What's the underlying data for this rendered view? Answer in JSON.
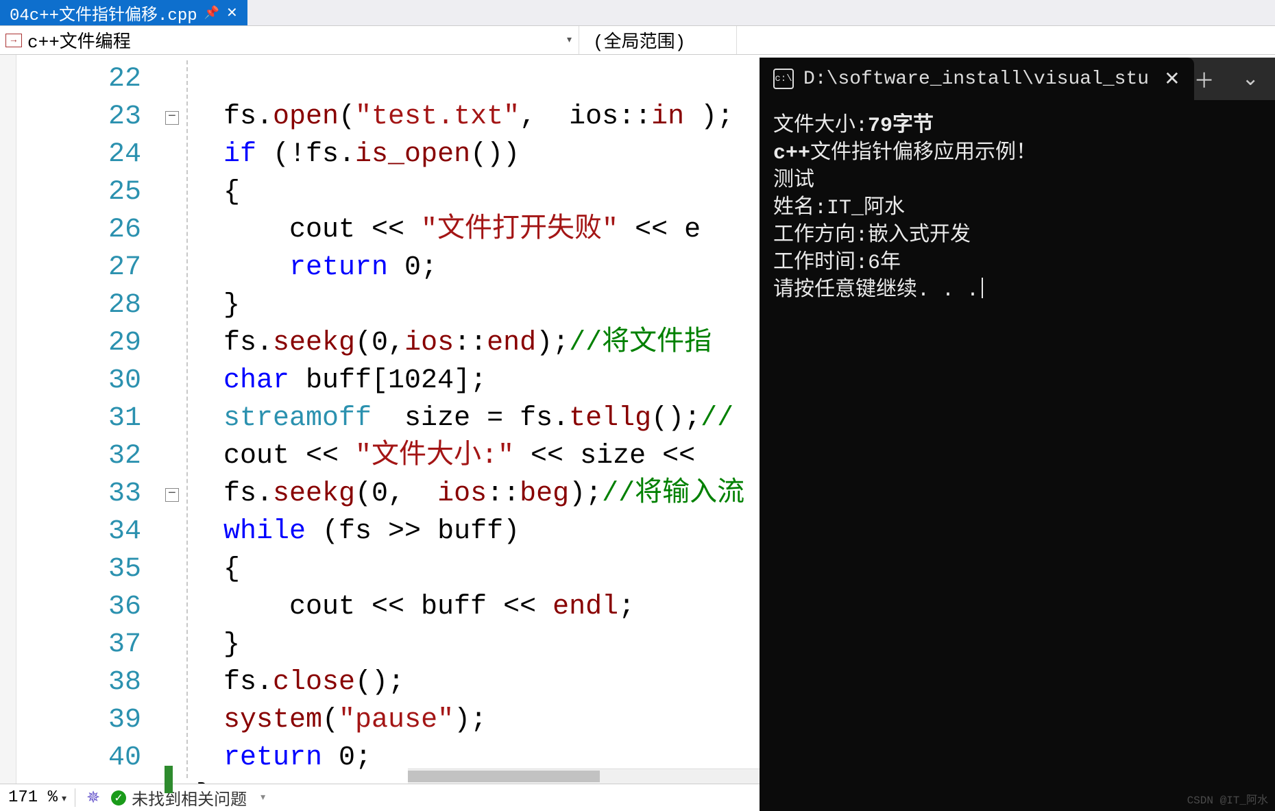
{
  "tab": {
    "title": "04c++文件指针偏移.cpp",
    "pin": "📌",
    "close": "✕"
  },
  "context": {
    "left_label": "c++文件编程",
    "right_label": "(全局范围)",
    "icon_text": "→"
  },
  "gutter": {
    "start": 22,
    "end": 40
  },
  "fold": {
    "rows": {
      "23": "−",
      "33": "−"
    }
  },
  "code": {
    "l22": {
      "a": "fs.",
      "b": "open",
      "c": "(",
      "d": "\"test.txt\"",
      "e": ",  ios::",
      "f": "in",
      "g": " );"
    },
    "l23": {
      "a": "if",
      "b": " (!fs.",
      "c": "is_open",
      "d": "())"
    },
    "l24": "{",
    "l25": {
      "a": "cout",
      "b": " << ",
      "c": "\"文件打开失败\"",
      "d": " << e"
    },
    "l26": {
      "a": "return",
      "b": " 0;"
    },
    "l27": "}",
    "l28": {
      "a": "fs.",
      "b": "seekg",
      "c": "(0,",
      "d": "ios",
      "e": "::",
      "f": "end",
      "g": ");",
      "h": "//将文件指"
    },
    "l29": {
      "a": "char",
      "b": " buff[1024];"
    },
    "l30": {
      "a": "streamoff",
      "b": "  size = fs.",
      "c": "tellg",
      "d": "();",
      "e": "//"
    },
    "l31": {
      "a": "cout",
      "b": " << ",
      "c": "\"文件大小:\"",
      "d": " << size << "
    },
    "l32": {
      "a": "fs.",
      "b": "seekg",
      "c": "(0,  ",
      "d": "ios",
      "e": "::",
      "f": "beg",
      "g": ");",
      "h": "//将输入流"
    },
    "l33": {
      "a": "while",
      "b": " (fs >> buff)"
    },
    "l34": "{",
    "l35": {
      "a": "cout",
      "b": " << buff << ",
      "c": "endl",
      "d": ";"
    },
    "l36": "}",
    "l37": {
      "a": "fs.",
      "b": "close",
      "c": "();"
    },
    "l38": {
      "a": "system",
      "b": "(",
      "c": "\"pause\"",
      "d": ");"
    },
    "l39": {
      "a": "return",
      "b": " 0;"
    },
    "l40": "}"
  },
  "status": {
    "zoom": "171 %",
    "issues": "未找到相关问题"
  },
  "console": {
    "title": "D:\\software_install\\visual_stu",
    "lines": {
      "l1a": "文件大小:",
      "l1b": "79字节",
      "l2a": "c++",
      "l2b": "文件指针偏移应用示例！",
      "l3": "测试",
      "l4": "姓名:IT_阿水",
      "l5": "工作方向:嵌入式开发",
      "l6": "工作时间:6年",
      "l7": "请按任意键继续. . ."
    },
    "new_tab": "＋",
    "dropdown": "⌄",
    "close": "✕"
  },
  "watermark": "CSDN @IT_阿水"
}
